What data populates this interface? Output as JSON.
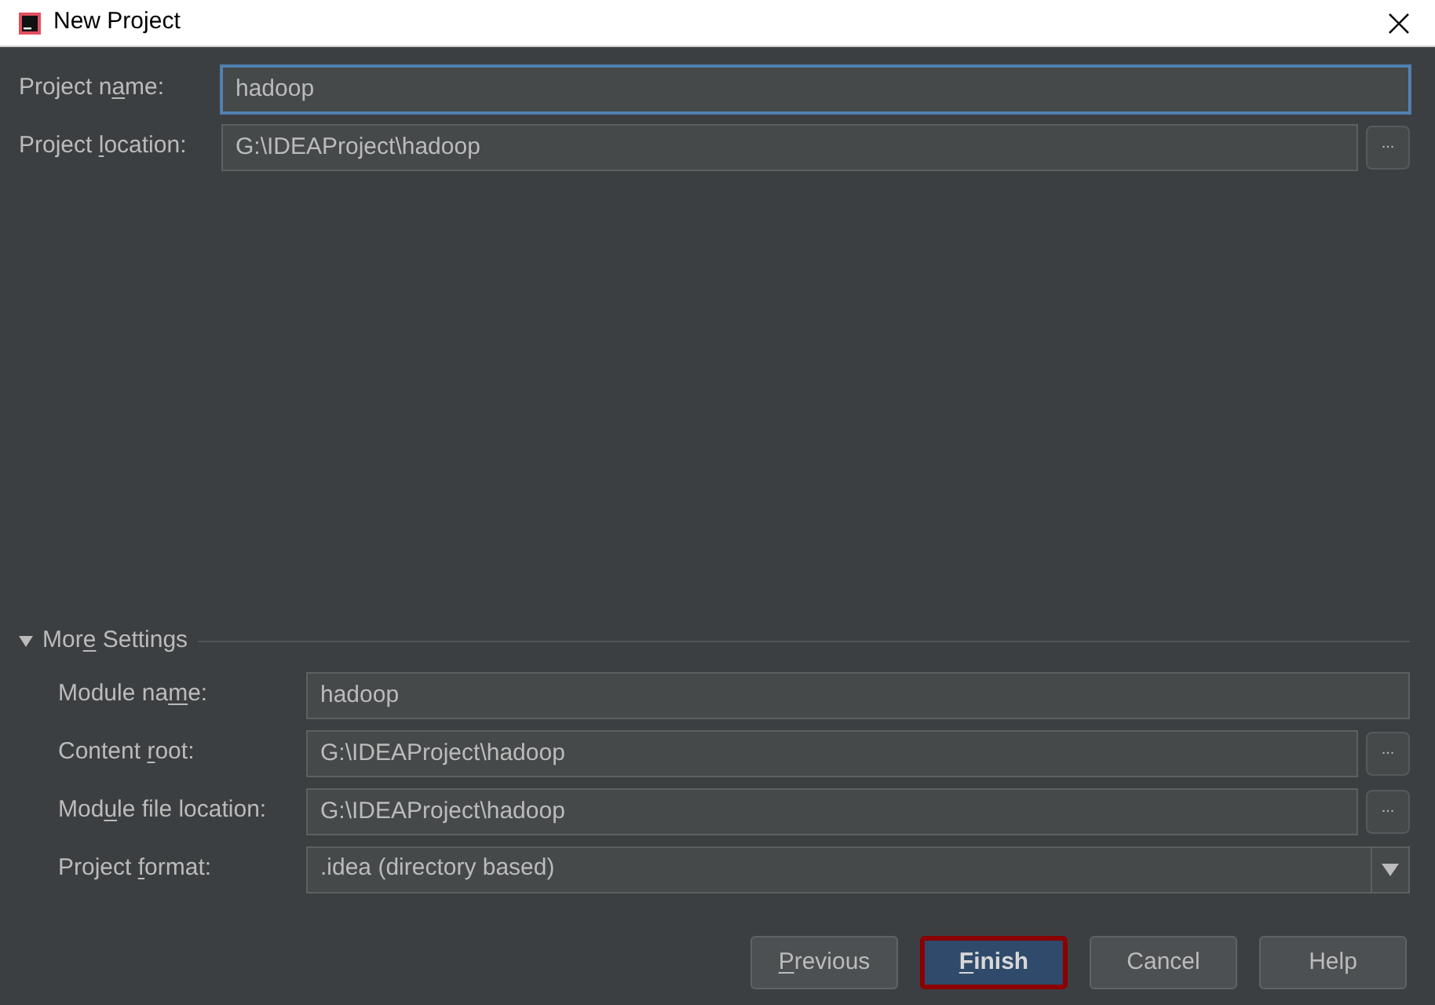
{
  "window": {
    "title": "New Project"
  },
  "fields": [
    {
      "label": [
        {
          "text": "Project n",
          "mnemonic": false
        },
        {
          "text": "a",
          "mnemonic": true
        },
        {
          "text": "me:",
          "mnemonic": false
        }
      ],
      "value": "hadoop",
      "focused": true,
      "browse": false
    },
    {
      "label": [
        {
          "text": "Project ",
          "mnemonic": false
        },
        {
          "text": "l",
          "mnemonic": true
        },
        {
          "text": "ocation:",
          "mnemonic": false
        }
      ],
      "value": "G:\\IDEAProject\\hadoop",
      "focused": false,
      "browse": true,
      "browse_label": "..."
    }
  ],
  "more_settings": {
    "label": [
      {
        "text": "Mor",
        "mnemonic": false
      },
      {
        "text": "e",
        "mnemonic": true
      },
      {
        "text": " Settings",
        "mnemonic": false
      }
    ],
    "expanded": true,
    "fields": [
      {
        "kind": "text",
        "label": [
          {
            "text": "Module na",
            "mnemonic": false
          },
          {
            "text": "m",
            "mnemonic": true
          },
          {
            "text": "e:",
            "mnemonic": false
          }
        ],
        "value": "hadoop",
        "browse": false
      },
      {
        "kind": "text",
        "label": [
          {
            "text": "Content ",
            "mnemonic": false
          },
          {
            "text": "r",
            "mnemonic": true
          },
          {
            "text": "oot:",
            "mnemonic": false
          }
        ],
        "value": "G:\\IDEAProject\\hadoop",
        "browse": true,
        "browse_label": "..."
      },
      {
        "kind": "text",
        "label": [
          {
            "text": "Mod",
            "mnemonic": false
          },
          {
            "text": "u",
            "mnemonic": true
          },
          {
            "text": "le file location:",
            "mnemonic": false
          }
        ],
        "value": "G:\\IDEAProject\\hadoop",
        "browse": true,
        "browse_label": "..."
      },
      {
        "kind": "dropdown",
        "label": [
          {
            "text": "Project ",
            "mnemonic": false
          },
          {
            "text": "f",
            "mnemonic": true
          },
          {
            "text": "ormat:",
            "mnemonic": false
          }
        ],
        "value": ".idea (directory based)",
        "browse": false
      }
    ]
  },
  "buttons": [
    {
      "label": [
        {
          "text": "P",
          "mnemonic": true
        },
        {
          "text": "revious",
          "mnemonic": false
        }
      ],
      "default": false,
      "focused": false
    },
    {
      "label": [
        {
          "text": "F",
          "mnemonic": true
        },
        {
          "text": "inish",
          "mnemonic": false
        }
      ],
      "default": true,
      "focused": true
    },
    {
      "label": [
        {
          "text": "Cancel",
          "mnemonic": false
        }
      ],
      "default": false,
      "focused": false
    },
    {
      "label": [
        {
          "text": "Help",
          "mnemonic": false
        }
      ],
      "default": false,
      "focused": false
    }
  ]
}
